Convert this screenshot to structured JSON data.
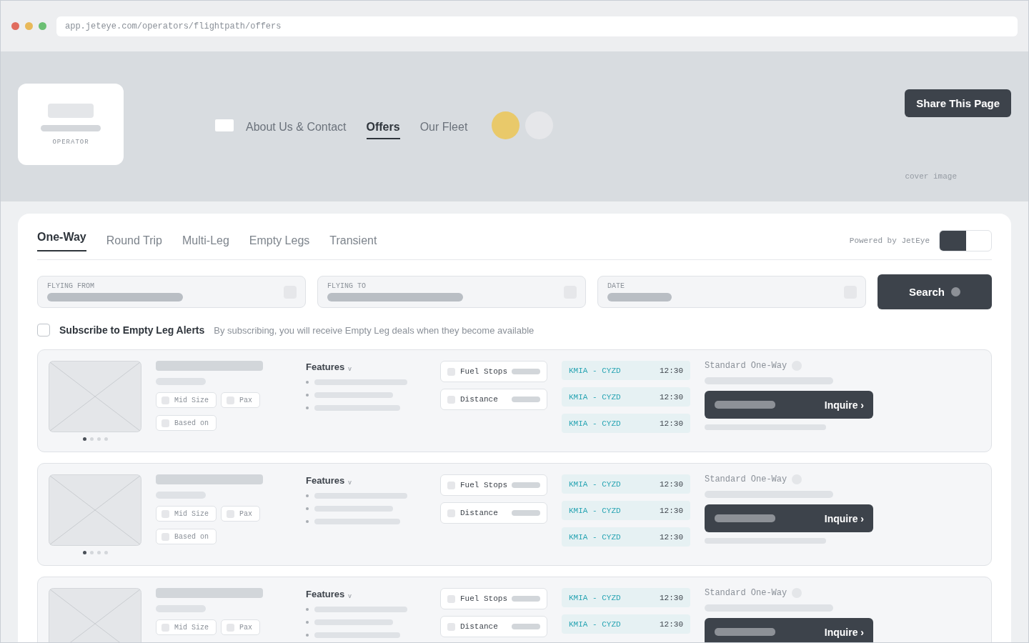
{
  "browser": {
    "url": "app.jeteye.com/operators/flightpath/offers"
  },
  "header": {
    "logo_label": "OPERATOR",
    "nav": [
      {
        "label": "About Us & Contact",
        "selected": false
      },
      {
        "label": "Offers",
        "selected": true
      },
      {
        "label": "Our Fleet",
        "selected": false
      }
    ],
    "share_button": "Share This Page",
    "cover_label": "cover image"
  },
  "search_panel": {
    "tabs": [
      {
        "label": "One-Way",
        "selected": true
      },
      {
        "label": "Round Trip",
        "selected": false
      },
      {
        "label": "Multi-Leg",
        "selected": false
      },
      {
        "label": "Empty Legs",
        "selected": false
      },
      {
        "label": "Transient",
        "selected": false
      }
    ],
    "powered_by": "Powered by JetEye",
    "toggle": {
      "on": true
    },
    "fields": [
      {
        "label": "FLYING FROM"
      },
      {
        "label": "FLYING TO"
      },
      {
        "label": "DATE"
      }
    ],
    "search_button": "Search",
    "subscribe": {
      "label": "Subscribe to Empty Leg Alerts",
      "checked": false,
      "note": "By subscribing, you will receive Empty Leg deals when they become available"
    }
  },
  "offers": [
    {
      "slides": [
        {
          "selected": true
        },
        {
          "selected": false
        },
        {
          "selected": false
        },
        {
          "selected": false
        }
      ],
      "chips": [
        "Mid Size",
        "Pax",
        "Based on"
      ],
      "features_label": "Features",
      "features_caret": "v",
      "options": [
        "Fuel Stops",
        "Distance"
      ],
      "routes": [
        {
          "route": "KMIA - CYZD",
          "time": "12:30"
        },
        {
          "route": "KMIA - CYZD",
          "time": "12:30"
        },
        {
          "route": "KMIA - CYZD",
          "time": "12:30"
        }
      ],
      "fare_label": "Standard One-Way",
      "inquire_button": "Inquire ›"
    },
    {
      "slides": [
        {
          "selected": true
        },
        {
          "selected": false
        },
        {
          "selected": false
        },
        {
          "selected": false
        }
      ],
      "chips": [
        "Mid Size",
        "Pax",
        "Based on"
      ],
      "features_label": "Features",
      "features_caret": "v",
      "options": [
        "Fuel Stops",
        "Distance"
      ],
      "routes": [
        {
          "route": "KMIA - CYZD",
          "time": "12:30"
        },
        {
          "route": "KMIA - CYZD",
          "time": "12:30"
        },
        {
          "route": "KMIA - CYZD",
          "time": "12:30"
        }
      ],
      "fare_label": "Standard One-Way",
      "inquire_button": "Inquire ›"
    },
    {
      "chips": [
        "Mid Size",
        "Pax"
      ],
      "features_label": "Features",
      "features_caret": "v",
      "options": [
        "Fuel Stops",
        "Distance"
      ],
      "routes": [
        {
          "route": "KMIA - CYZD",
          "time": "12:30"
        },
        {
          "route": "KMIA - CYZD",
          "time": "12:30"
        }
      ],
      "fare_label": "Standard One-Way",
      "inquire_button": "Inquire ›"
    }
  ]
}
